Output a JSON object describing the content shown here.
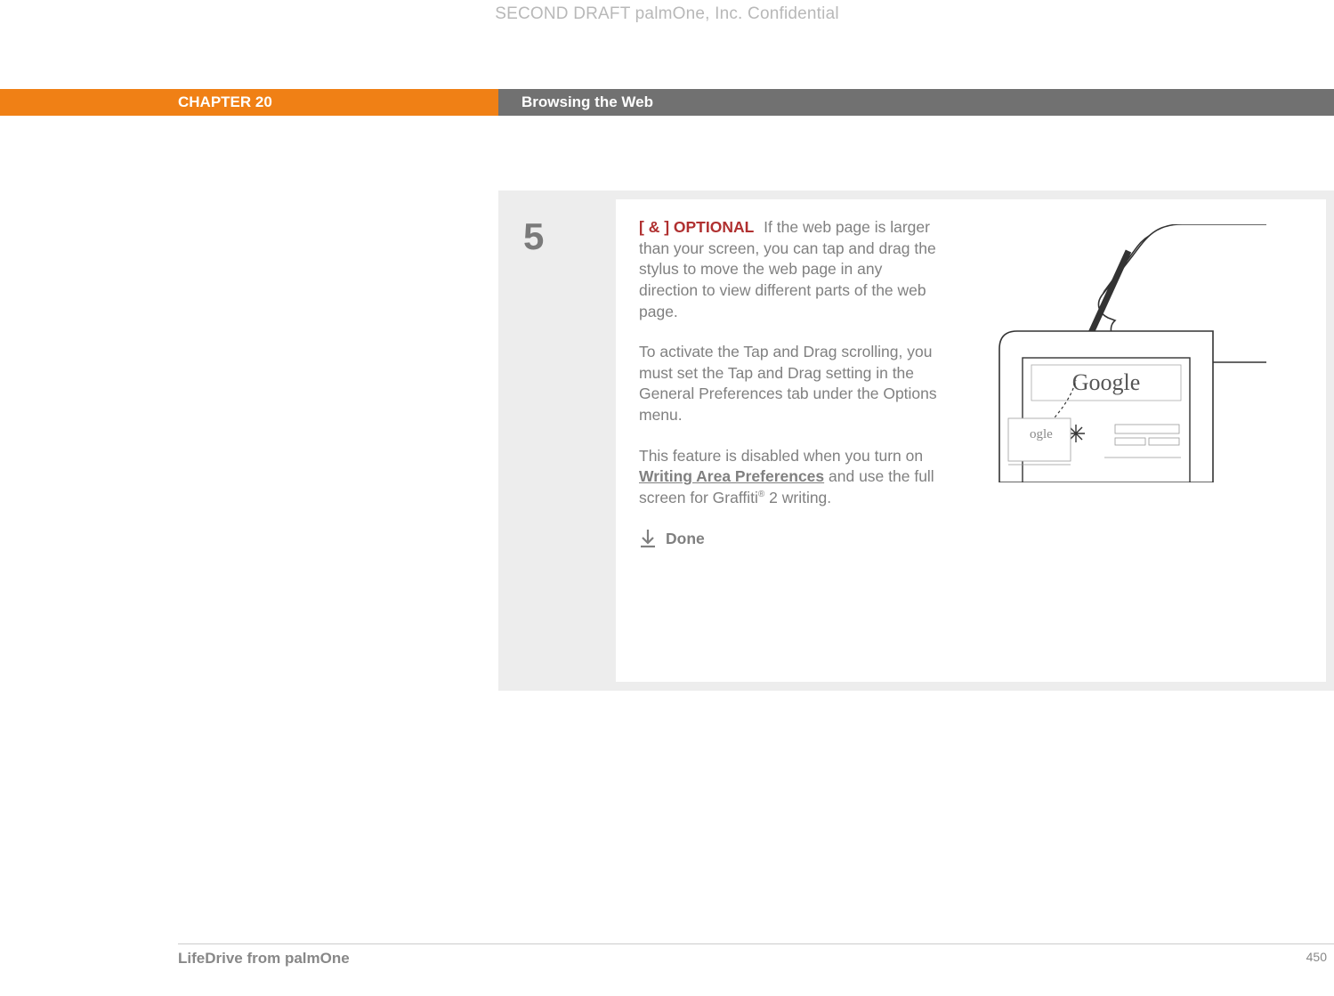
{
  "header": {
    "confidential": "SECOND DRAFT palmOne, Inc.  Confidential"
  },
  "chapter": {
    "label": "CHAPTER 20",
    "title": "Browsing the Web"
  },
  "step": {
    "number": "5",
    "optional_tag": "[ & ]  OPTIONAL",
    "para1": "If the web page is larger than your screen, you can tap and drag the stylus to move the web page in any direction to view different parts of the web page.",
    "para2": "To activate the Tap and Drag scrolling, you must set the Tap and Drag setting in the General Preferences tab under the Options menu.",
    "para3_a": "This feature is disabled when you turn on ",
    "para3_link": "Writing Area Preferences",
    "para3_b": " and use the full screen for Graffiti",
    "para3_sup": "®",
    "para3_c": " 2 writing.",
    "done": "Done"
  },
  "footer": {
    "product": "LifeDrive from palmOne",
    "page": "450"
  }
}
